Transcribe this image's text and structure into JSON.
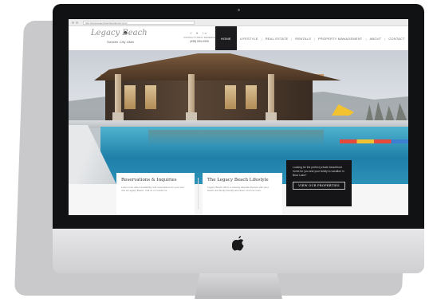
{
  "browser": {
    "url": "http://www.legacybeachgardencity.com/"
  },
  "header": {
    "logo_text": "Legacy Beach",
    "logo_subtitle": "Garden City Utah",
    "social_icons": "f ✦ in",
    "contact_line": "CONTACT TODAY RESERVE",
    "phone": "(435) 000-0000"
  },
  "nav": {
    "items": [
      {
        "label": "HOME",
        "active": true
      },
      {
        "label": "LIFESTYLE",
        "active": false
      },
      {
        "label": "REAL ESTATE",
        "active": false
      },
      {
        "label": "RENTALS",
        "active": false
      },
      {
        "label": "PROPERTY MANAGEMENT",
        "active": false
      },
      {
        "label": "ABOUT",
        "active": false
      },
      {
        "label": "CONTACT",
        "active": false
      }
    ],
    "separator": "|"
  },
  "cards": [
    {
      "title": "Reservations & Inquiries",
      "text": "Learn more about availability and reservations for your next visit at Legacy Beach. Call us or contact us."
    },
    {
      "title": "The Legacy Beach Lifestyle",
      "text": "Legacy Beach offers a relaxing lakeside lifestyle with pool, beach and family friendly amenities. Find out more."
    }
  ],
  "cta": {
    "text": "Looking for the perfect private beachfront home for you and your family to vacation in Bear Lake?",
    "button_label": "VIEW OUR PROPERTIES"
  },
  "colors": {
    "nav_active_bg": "#1c1c1e",
    "cta_bg": "#151517",
    "pool_water": "#1f7fa8"
  }
}
